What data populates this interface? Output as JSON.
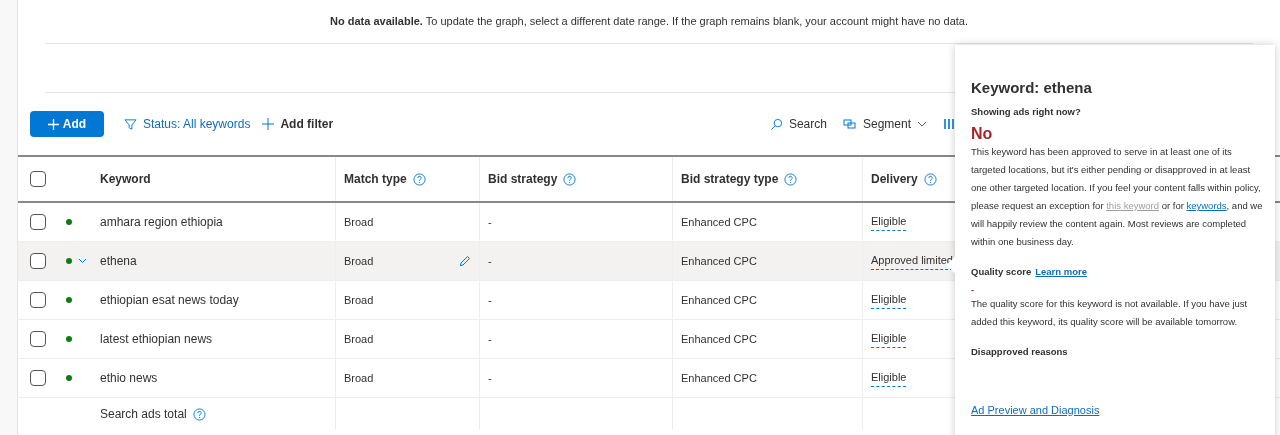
{
  "notice": {
    "bold": "No data available.",
    "text": "To update the graph, select a different date range. If the graph remains blank, your account might have no data."
  },
  "toolbar": {
    "add": "Add",
    "status_filter": "Status: All keywords",
    "add_filter": "Add filter",
    "search": "Search",
    "segment": "Segment"
  },
  "table": {
    "columns": [
      {
        "label": "Keyword",
        "help": false
      },
      {
        "label": "Match type",
        "help": true
      },
      {
        "label": "Bid strategy",
        "help": true
      },
      {
        "label": "Bid strategy type",
        "help": true
      },
      {
        "label": "Delivery",
        "help": true
      }
    ],
    "rows": [
      {
        "keyword": "amhara region ethiopia",
        "match_type": "Broad",
        "bid_strategy": "-",
        "bid_strategy_type": "Enhanced CPC",
        "delivery": "Eligible",
        "checked": false,
        "hovered": false,
        "color": "#107c10"
      },
      {
        "keyword": "ethena",
        "match_type": "Broad",
        "bid_strategy": "-",
        "bid_strategy_type": "Enhanced CPC",
        "delivery": "Approved limited",
        "checked": false,
        "hovered": true,
        "color": "#107c10"
      },
      {
        "keyword": "ethiopian esat news today",
        "match_type": "Broad",
        "bid_strategy": "-",
        "bid_strategy_type": "Enhanced CPC",
        "delivery": "Eligible",
        "checked": false,
        "hovered": false,
        "color": "#107c10"
      },
      {
        "keyword": "latest ethiopian news",
        "match_type": "Broad",
        "bid_strategy": "-",
        "bid_strategy_type": "Enhanced CPC",
        "delivery": "Eligible",
        "checked": false,
        "hovered": false,
        "color": "#107c10"
      },
      {
        "keyword": "ethio news",
        "match_type": "Broad",
        "bid_strategy": "-",
        "bid_strategy_type": "Enhanced CPC",
        "delivery": "Eligible",
        "checked": false,
        "hovered": false,
        "color": "#107c10"
      }
    ],
    "total": "Search ads total",
    "select_all_checked": false
  },
  "popup": {
    "title": "Keyword: ethena",
    "question": "Showing ads right now?",
    "answer": "No",
    "message": [
      {
        "kind": "text",
        "text": "This keyword has been approved to serve in at least one of its targeted locations, but it's either pending or disapproved in at least one other targeted location. If you feel your content falls within policy, please request an exception for "
      },
      {
        "kind": "link",
        "text": "this keyword",
        "disabled": true
      },
      {
        "kind": "text",
        "text": " or for "
      },
      {
        "kind": "link",
        "text": "keywords",
        "disabled": false
      },
      {
        "kind": "text",
        "text": ", and we will happily review the content again. Most reviews are completed within one business day."
      }
    ],
    "quality_label": "Quality score",
    "quality_link": "Learn more",
    "quality_value": "-",
    "quality_text": "The quality score for this keyword is not available. If you have just added this keyword, its quality score will be available tomorrow.",
    "disapproved_label": "Disapproved reasons",
    "diagnosis_link": "Ad Preview and Diagnosis"
  }
}
